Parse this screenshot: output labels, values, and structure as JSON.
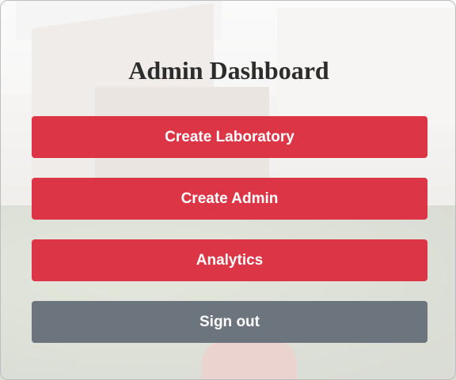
{
  "page": {
    "title": "Admin Dashboard"
  },
  "actions": {
    "create_laboratory": "Create Laboratory",
    "create_admin": "Create Admin",
    "analytics": "Analytics",
    "sign_out": "Sign out"
  },
  "colors": {
    "primary_action": "#dc3545",
    "secondary_action": "#6c757d",
    "title_text": "#2c2c2c"
  }
}
